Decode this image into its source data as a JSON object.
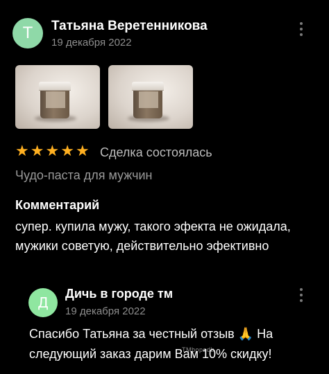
{
  "review": {
    "avatar_letter": "Т",
    "author": "Татьяна Веретенникова",
    "date": "19 декабря 2022",
    "rating": 5,
    "stars": [
      "★",
      "★",
      "★",
      "★",
      "★"
    ],
    "deal_status": "Сделка состоялась",
    "product": "Чудо-паста для мужчин",
    "comment_heading": "Комментарий",
    "comment_text": "супер. купила мужу, такого эфекта не ожидала, мужики советую, действительно эфективно"
  },
  "reply": {
    "avatar_letter": "Д",
    "author": "Дичь в городе тм",
    "date": "19 декабря 2022",
    "text_before_emoji": "Спасибо Татьяна за честный отзыв ",
    "emoji": "🙏",
    "text_after_emoji": " На следующий заказ дарим Вам 10% скидку!"
  },
  "watermark": "TMbopodb",
  "colors": {
    "background": "#000000",
    "star": "#ffb021",
    "avatar_main": "#8fd9a8",
    "avatar_reply": "#8fe6a0",
    "muted_text": "#8e8e8e"
  },
  "icons": [
    "more-vertical-icon",
    "star-icon",
    "folded-hands-icon"
  ]
}
